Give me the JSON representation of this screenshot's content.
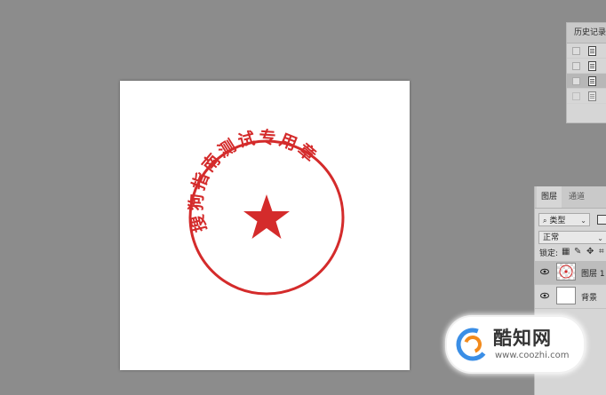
{
  "document": {
    "stamp": {
      "text": "搜狗指南测试专用章",
      "color": "#d42b2b",
      "center_icon": "star-icon"
    }
  },
  "history_panel": {
    "title": "历史记录",
    "rows": [
      {
        "label": "",
        "selected": false
      },
      {
        "label": "",
        "selected": false
      },
      {
        "label": "",
        "selected": true
      },
      {
        "label": "",
        "selected": false
      }
    ]
  },
  "layers_panel": {
    "tabs": [
      "图层",
      "通道"
    ],
    "filter": {
      "icon": "search-icon",
      "value": "类型"
    },
    "blend_mode": "正常",
    "lock_label": "锁定:",
    "lock_icons": [
      "lock-transparent-icon",
      "brush-icon",
      "move-icon",
      "artboard-icon"
    ],
    "layers": [
      {
        "name": "图层 1",
        "selected": true,
        "visible": true
      },
      {
        "name": "背景",
        "selected": false,
        "visible": true
      }
    ]
  },
  "watermark": {
    "brand": "酷知网",
    "url": "www.coozhi.com"
  }
}
